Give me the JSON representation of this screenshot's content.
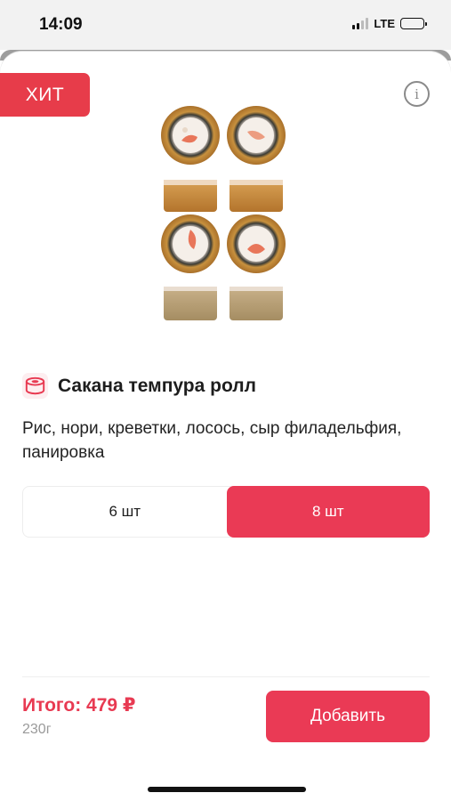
{
  "status_bar": {
    "time": "14:09",
    "network": "LTE",
    "battery_level": 0.45
  },
  "product": {
    "badge": "ХИТ",
    "info_icon": "info-icon",
    "category_icon": "sushi-roll-icon",
    "name": "Сакана темпура ролл",
    "description": "Рис, нори, креветки, лосось, сыр филадельфия, панировка",
    "image": "tempura-roll-photo"
  },
  "portion_switch": {
    "options": [
      "6 шт",
      "8 шт"
    ],
    "selected": "8 шт"
  },
  "footer": {
    "total": "Итого: 479 ₽",
    "weight": "230г",
    "add_button": "Добавить"
  },
  "colors": {
    "accent": "#ea3a55",
    "badge": "#e73c4a",
    "price_text": "#e83a52",
    "muted_text": "#9a9a9a"
  }
}
